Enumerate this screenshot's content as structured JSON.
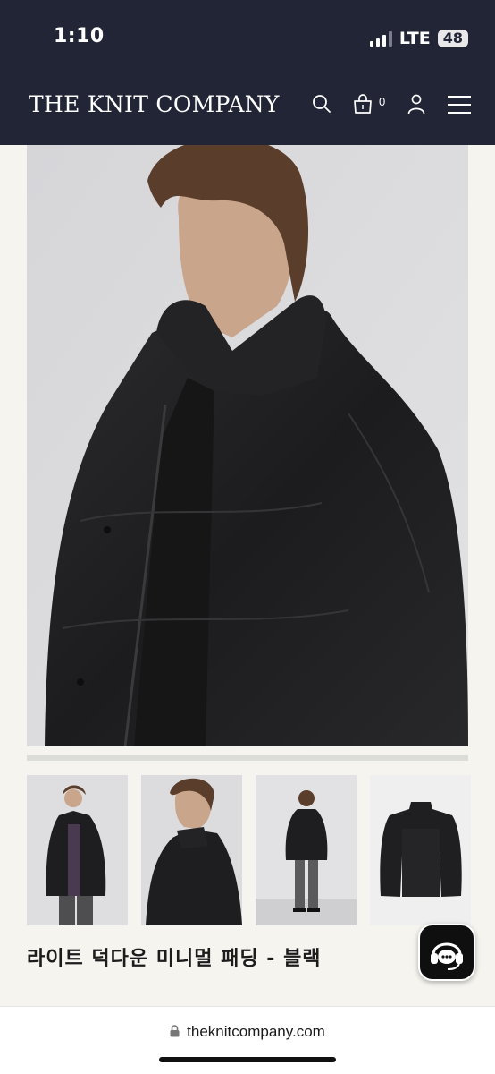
{
  "status_bar": {
    "time": "1:10",
    "network": "LTE",
    "battery": "48"
  },
  "header": {
    "brand": "THE KNIT COMPANY",
    "cart_count": "0",
    "icons": [
      "search-icon",
      "cart-icon",
      "account-icon",
      "menu-icon"
    ]
  },
  "product": {
    "title": "라이트 덕다운 미니멀 패딩 - 블랙",
    "thumbnails": [
      "front-model",
      "side-model",
      "back-model",
      "flat-lay"
    ]
  },
  "browser": {
    "url": "theknitcompany.com"
  },
  "colors": {
    "header_bg": "#222536",
    "page_bg": "#f6f4ef"
  }
}
